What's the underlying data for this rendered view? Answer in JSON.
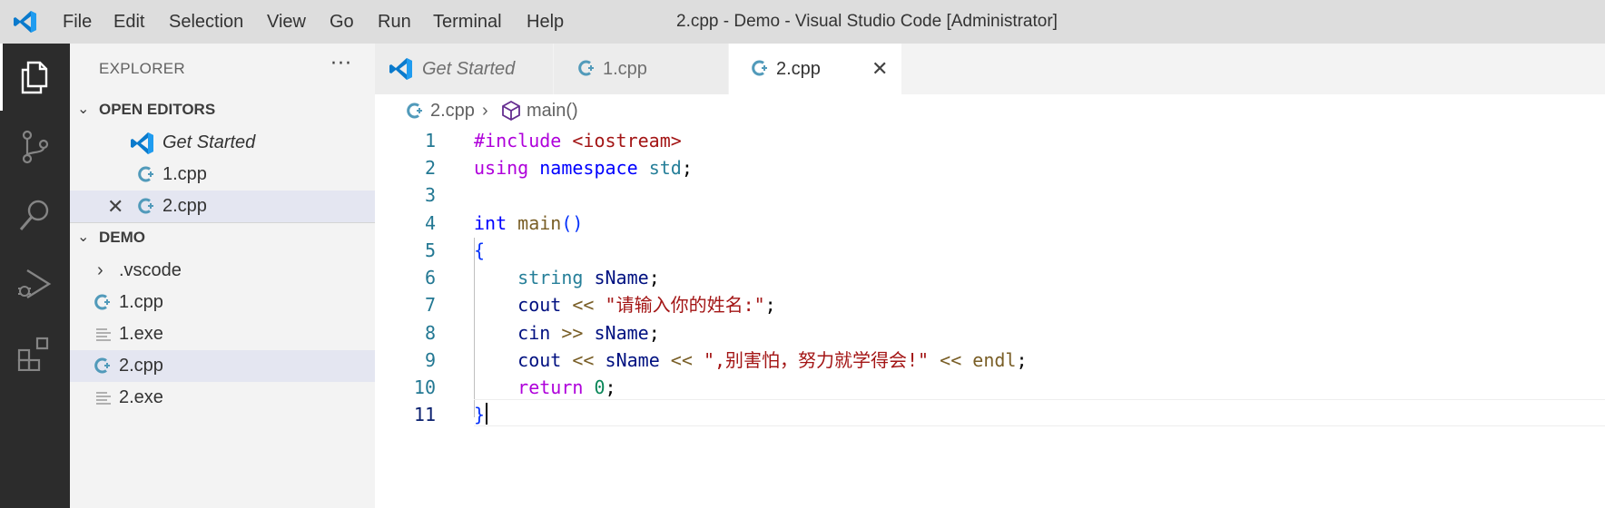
{
  "titlebar": {
    "menu": [
      "File",
      "Edit",
      "Selection",
      "View",
      "Go",
      "Run",
      "Terminal",
      "Help"
    ],
    "window_title": "2.cpp - Demo - Visual Studio Code [Administrator]"
  },
  "activity_bar": [
    "files-icon",
    "source-control-icon",
    "search-icon",
    "run-debug-icon",
    "extensions-icon"
  ],
  "sidebar": {
    "title": "EXPLORER",
    "more": "···",
    "open_editors": {
      "label": "OPEN EDITORS",
      "items": [
        "Get Started",
        "1.cpp",
        "2.cpp"
      ]
    },
    "folder": {
      "label": "DEMO",
      "items": [
        ".vscode",
        "1.cpp",
        "1.exe",
        "2.cpp",
        "2.exe"
      ]
    }
  },
  "tabs": [
    "Get Started",
    "1.cpp",
    "2.cpp"
  ],
  "breadcrumb": {
    "file": "2.cpp",
    "symbol": "main()"
  },
  "editor": {
    "line_numbers": [
      "1",
      "2",
      "3",
      "4",
      "5",
      "6",
      "7",
      "8",
      "9",
      "10",
      "11"
    ],
    "tokens": {
      "include": "#include",
      "iostream": "<iostream>",
      "using": "using",
      "namespace": "namespace",
      "std": "std",
      "int": "int",
      "main": "main",
      "parens": "()",
      "open_brace": "{",
      "string": "string",
      "sName": "sName",
      "cout": "cout",
      "cin": "cin",
      "shl": "<<",
      "shr": ">>",
      "prompt": "\"请输入你的姓名:\"",
      "encourage": "\",别害怕，努力就学得会!\"",
      "endl": "endl",
      "return": "return",
      "zero": "0",
      "close_brace": "}",
      "semicolon": ";"
    }
  },
  "colors": {
    "accent": "#007acc",
    "cpp_icon": "#519aba",
    "activity_bg": "#2c2c2c"
  }
}
